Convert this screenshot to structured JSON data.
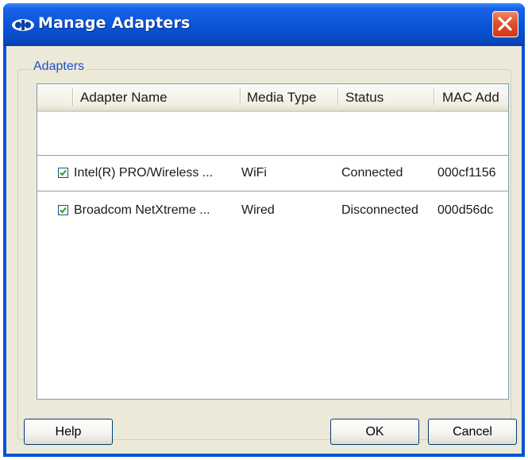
{
  "window": {
    "title": "Manage Adapters",
    "icon": "network-icon",
    "close_icon": "close-icon"
  },
  "group": {
    "label": "Adapters"
  },
  "list": {
    "columns": [
      "Adapter Name",
      "Media Type",
      "Status",
      "MAC Add"
    ],
    "rows": [
      {
        "checked": true,
        "name": "Intel(R) PRO/Wireless ...",
        "media": "WiFi",
        "status": "Connected",
        "mac": "000cf1156"
      },
      {
        "checked": true,
        "name": "Broadcom NetXtreme ...",
        "media": "Wired",
        "status": "Disconnected",
        "mac": "000d56dc"
      }
    ]
  },
  "scrollbar": {
    "left_icon": "chevron-left-icon",
    "right_icon": "chevron-right-icon"
  },
  "buttons": {
    "help": "Help",
    "ok": "OK",
    "cancel": "Cancel"
  },
  "colors": {
    "titlebar": "#0a55d8",
    "client": "#ece9d8",
    "close": "#e2532e",
    "group_label": "#1f4fc8"
  }
}
